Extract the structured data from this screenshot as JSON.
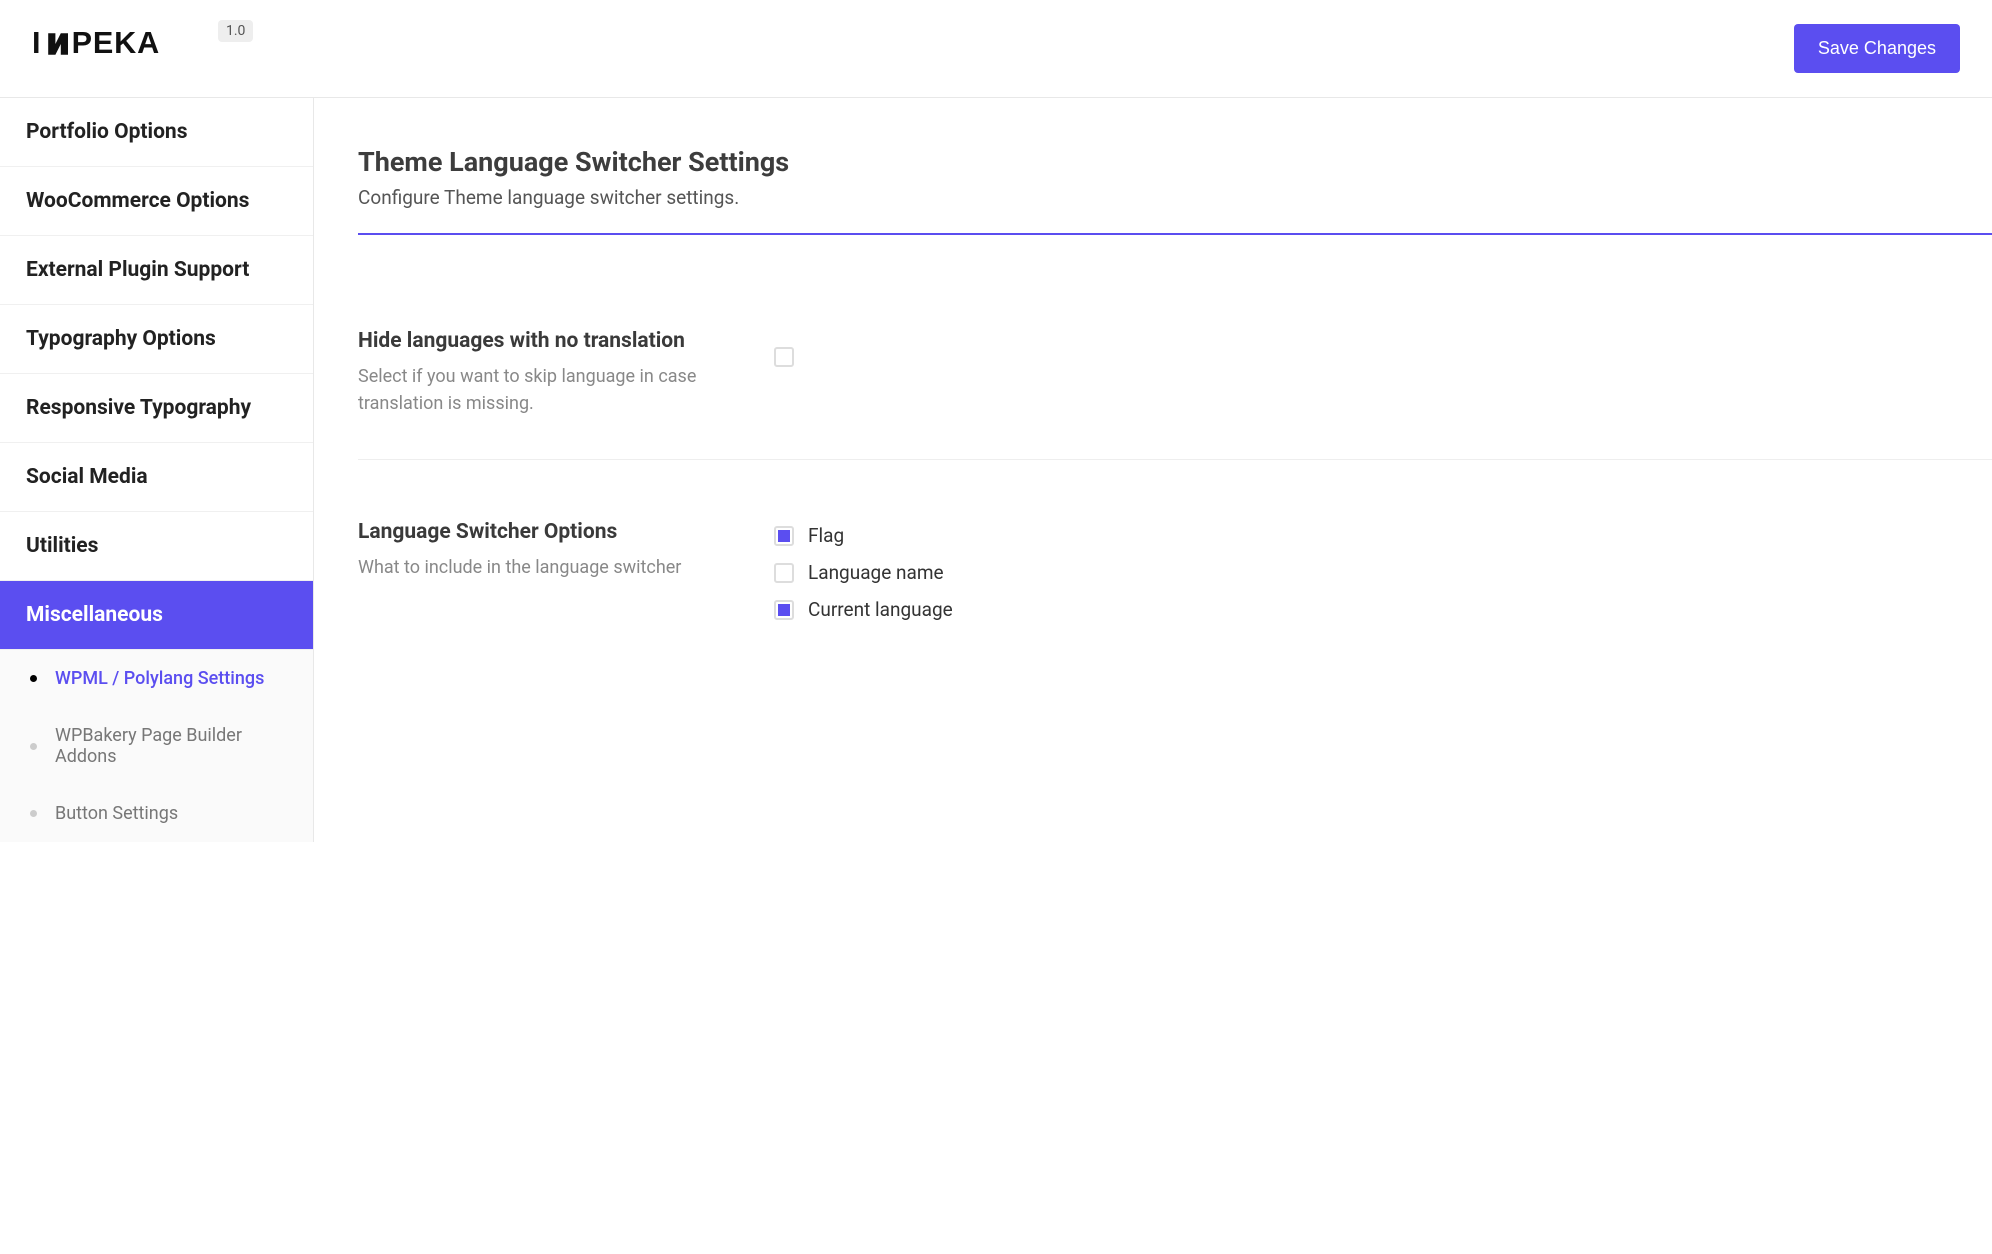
{
  "header": {
    "logo_text": "IMPEKA",
    "version": "1.0",
    "save_button": "Save Changes"
  },
  "sidebar": {
    "items": [
      {
        "label": "Portfolio Options",
        "active": false
      },
      {
        "label": "WooCommerce Options",
        "active": false
      },
      {
        "label": "External Plugin Support",
        "active": false
      },
      {
        "label": "Typography Options",
        "active": false
      },
      {
        "label": "Responsive Typography",
        "active": false
      },
      {
        "label": "Social Media",
        "active": false
      },
      {
        "label": "Utilities",
        "active": false
      },
      {
        "label": "Miscellaneous",
        "active": true
      }
    ],
    "sub_items": [
      {
        "label": "WPML / Polylang Settings",
        "active": true
      },
      {
        "label": "WPBakery Page Builder Addons",
        "active": false
      },
      {
        "label": "Button Settings",
        "active": false
      }
    ]
  },
  "content": {
    "title": "Theme Language Switcher Settings",
    "subtitle": "Configure Theme language switcher settings.",
    "settings": {
      "hide_languages": {
        "label": "Hide languages with no translation",
        "desc": "Select if you want to skip language in case translation is missing.",
        "checked": false
      },
      "switcher_options": {
        "label": "Language Switcher Options",
        "desc": "What to include in the language switcher",
        "options": [
          {
            "label": "Flag",
            "checked": true
          },
          {
            "label": "Language name",
            "checked": false
          },
          {
            "label": "Current language",
            "checked": true
          }
        ]
      }
    }
  }
}
